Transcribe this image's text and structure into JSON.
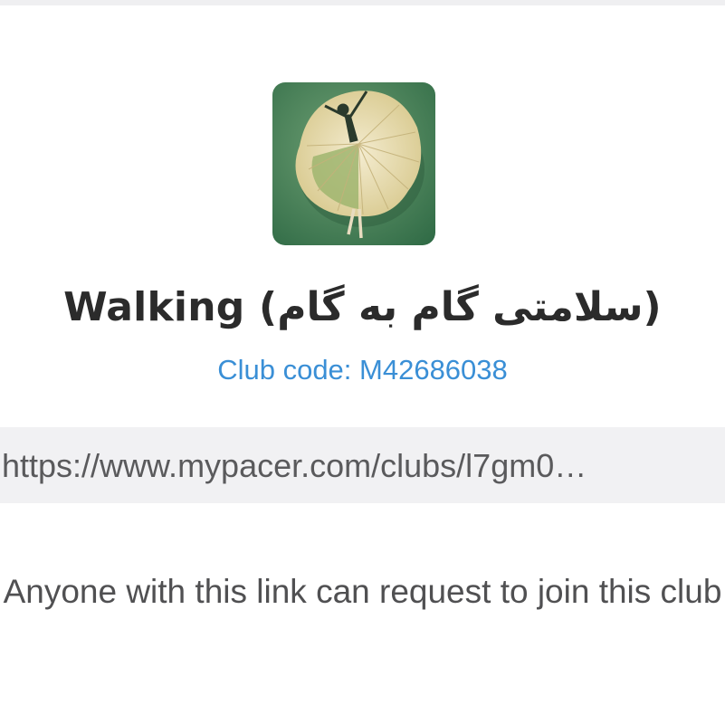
{
  "club": {
    "name": "Walking (سلامتی گام به گام)",
    "code_label": "Club code: M42686038",
    "avatar_icon": "ballerina-leaf-avatar"
  },
  "share": {
    "link": "https://www.mypacer.com/clubs/l7gm0…",
    "note": "Anyone with this link can request to join this club"
  },
  "colors": {
    "code_blue": "#3a8fd6",
    "link_box_bg": "#f1f1f3",
    "title_text": "#2b2b2b"
  }
}
